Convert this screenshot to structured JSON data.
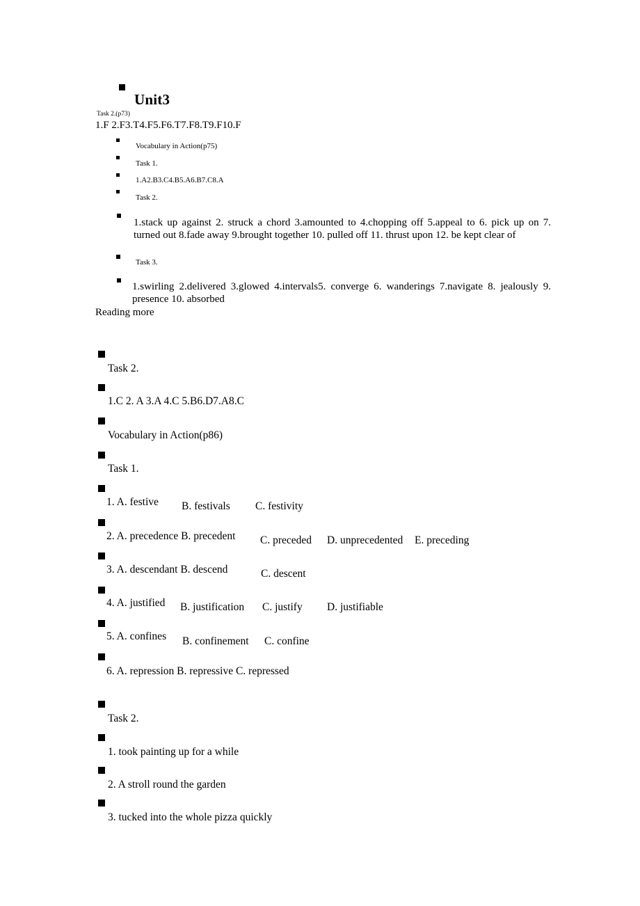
{
  "document": {
    "title": "Unit3",
    "sections": [
      {
        "id": "unit3-top",
        "small_heading": "Task 2.(p73)",
        "answers_line": "1.F 2.F3.T4.F5.F6.T7.F8.T9.F10.F",
        "items": [
          {
            "label": "Vocabulary in Action(p75)"
          },
          {
            "label": "Task 1."
          },
          {
            "label": "1.A2.B3.C4.B5.A6.B7.C8.A"
          },
          {
            "label": "Task 2."
          },
          {
            "label": "1.stack up against 2. struck a chord 3.amounted to 4.chopping off 5.appeal to 6. pick up on 7. turned out 8.fade away 9.brought together 10. pulled off 11. thrust upon 12. be kept clear of"
          },
          {
            "label": "Task 3."
          },
          {
            "label": "1.swirling  2.delivered  3.glowed  4.intervals5.  converge  6.  wanderings  7.navigate  8. jealously 9. presence 10. absorbed"
          }
        ]
      },
      {
        "id": "reading-more",
        "heading": "Reading more",
        "items": [
          {
            "label": "Task 2."
          },
          {
            "label": "1.C 2. A 3.A 4.C 5.B6.D7.A8.C"
          },
          {
            "label": "Vocabulary in Action(p86)"
          },
          {
            "label": "Task 1."
          }
        ]
      }
    ]
  },
  "vocab_task1": {
    "questions": [
      {
        "number": "1.",
        "options": [
          "A. festive",
          "B. festivals",
          "C. festivity"
        ]
      },
      {
        "number": "2.",
        "options": [
          "A. precedence",
          "B. precedent",
          "C. preceded",
          "D. unprecedented",
          "E. preceding"
        ]
      },
      {
        "number": "3.",
        "options": [
          "A. descendant",
          "B. descend",
          "C. descent"
        ]
      },
      {
        "number": "4.",
        "options": [
          "A. justified",
          "B. justification",
          "C. justify",
          "D. justifiable"
        ]
      },
      {
        "number": "5.",
        "options": [
          "A. confines",
          "B. confinement",
          "C. confine"
        ]
      },
      {
        "number": "6.",
        "options": [
          "A. repression",
          "B. repressive",
          "C. repressed"
        ]
      }
    ],
    "lines": [
      "1. A. festive",
      "B. festivals",
      "C. festivity",
      "2. A. precedence B. precedent",
      "C. preceded",
      "D. unprecedented",
      "E. preceding",
      "3. A. descendant B. descend",
      "C. descent",
      "4. A. justified",
      "B. justification",
      "C. justify",
      "D. justifiable",
      "5. A. confines",
      "B. confinement",
      "C. confine",
      "6. A. repression B. repressive C. repressed"
    ]
  },
  "vocab_task2": {
    "heading": "Task 2.",
    "answers": [
      "1. took painting up for a while",
      "2. A stroll round the garden",
      "3. tucked into the whole pizza quickly"
    ]
  },
  "style": {
    "text_color": "#000000",
    "page_background": "#ffffff",
    "bullet_color": "#000000"
  }
}
